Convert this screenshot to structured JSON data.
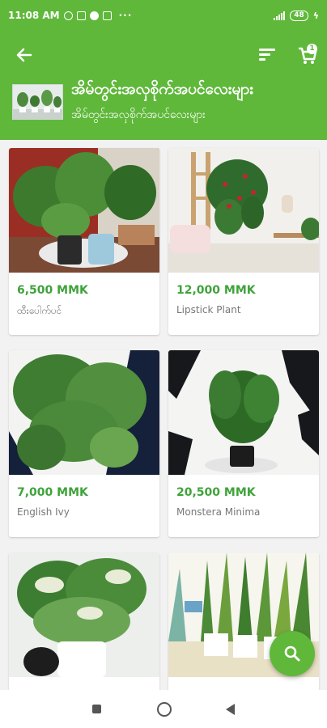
{
  "status_bar": {
    "time": "11:08 AM",
    "more": "···",
    "battery": "48",
    "signal_icon": "cellular-signal-icon",
    "bolt_icon": "charging-bolt-icon"
  },
  "app_bar": {
    "back_icon": "arrow-back-icon",
    "sort_icon": "sort-icon",
    "cart_icon": "shopping-cart-icon",
    "cart_count": "1",
    "category_title": "အိမ်တွင်းအလှစိုက်အပင်လေးများ",
    "category_subtitle": "အိမ်တွင်းအလှစိုက်အပင်လေးများ"
  },
  "products": [
    {
      "price": "6,500 MMK",
      "name": "ထီးပေါက်ပင်"
    },
    {
      "price": "12,000 MMK",
      "name": "Lipstick Plant"
    },
    {
      "price": "7,000 MMK",
      "name": "English Ivy"
    },
    {
      "price": "20,500 MMK",
      "name": "Monstera Minima"
    },
    {
      "price": "",
      "name": ""
    },
    {
      "price": "",
      "name": ""
    }
  ],
  "fab": {
    "icon": "search-icon"
  },
  "nav": {
    "recents_icon": "recents-square-icon",
    "home_icon": "home-circle-icon",
    "back_icon": "back-triangle-icon"
  },
  "colors": {
    "primary": "#5fb83a",
    "price": "#3fa33a",
    "background": "#f2f2f2"
  }
}
